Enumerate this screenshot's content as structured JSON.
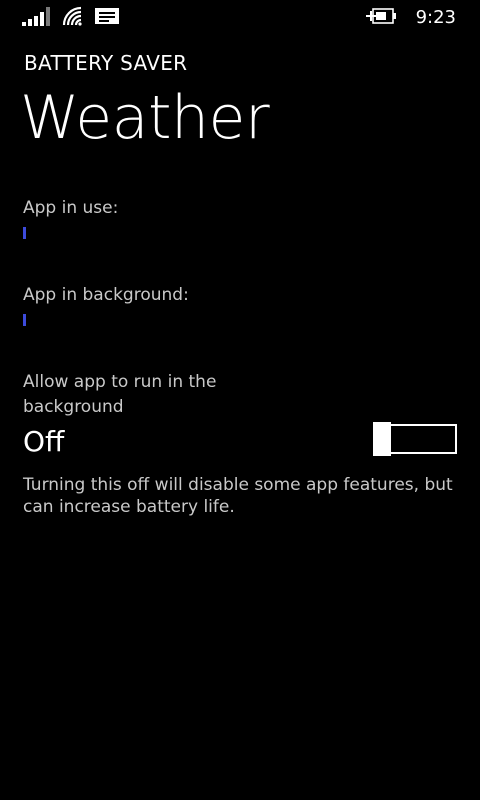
{
  "status_bar": {
    "icons": [
      "signal-strength-icon",
      "wifi-icon",
      "message-icon",
      "battery-charging-icon"
    ],
    "time": "9:23"
  },
  "header": {
    "app_title": "BATTERY SAVER",
    "page_title": "Weather"
  },
  "usage": {
    "in_use": {
      "label": "App in use:",
      "percent": 0
    },
    "background": {
      "label": "App in background:",
      "percent": 0
    },
    "bar_color": "#3d4bdb"
  },
  "background_setting": {
    "label": "Allow app to run in the background",
    "state_label": "Off",
    "toggle_on": false,
    "description": "Turning this off will disable some app features, but can increase battery life."
  }
}
